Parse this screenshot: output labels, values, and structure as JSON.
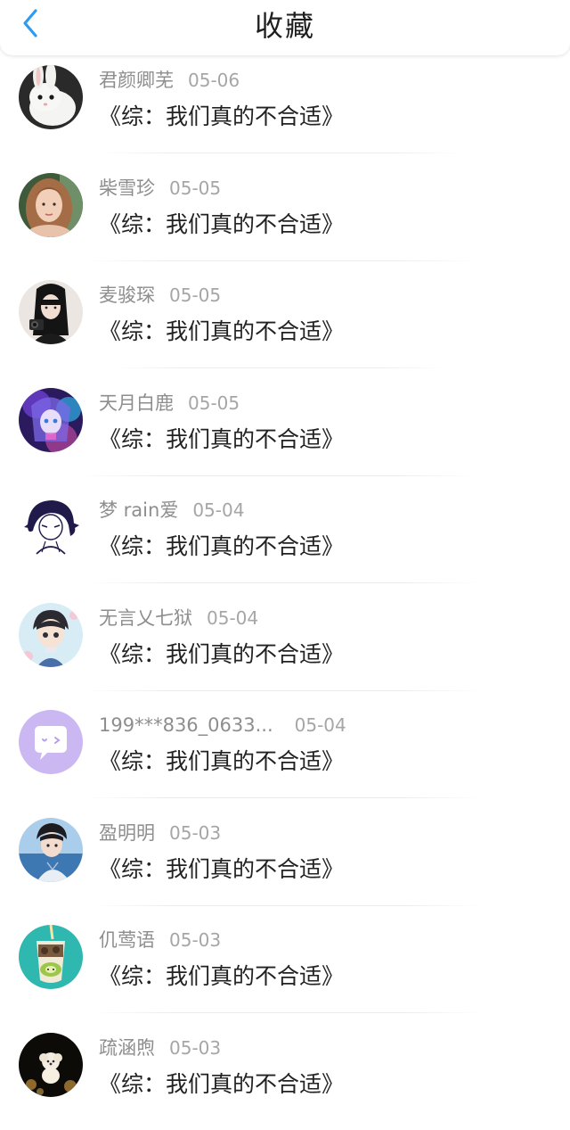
{
  "header": {
    "title": "收藏",
    "back_icon": "chevron-left-icon",
    "accent_color": "#2d9bf0"
  },
  "favorites": [
    {
      "name": "君颜卿芜",
      "date": "05-06",
      "title": "《综：我们真的不合适》",
      "avatar": "white-rabbit"
    },
    {
      "name": "柴雪珍",
      "date": "05-05",
      "title": "《综：我们真的不合适》",
      "avatar": "girl-portrait"
    },
    {
      "name": "麦骏琛",
      "date": "05-05",
      "title": "《综：我们真的不合适》",
      "avatar": "girl-with-camera"
    },
    {
      "name": "天月白鹿",
      "date": "05-05",
      "title": "《综：我们真的不合适》",
      "avatar": "anime-neon"
    },
    {
      "name": "梦 rain爱",
      "date": "05-04",
      "title": "《综：我们真的不合适》",
      "avatar": "anime-sketch"
    },
    {
      "name": "无言乂七狱",
      "date": "05-04",
      "title": "《综：我们真的不合适》",
      "avatar": "chibi-character"
    },
    {
      "name": "199***836_0633...",
      "date": "05-04",
      "title": "《综：我们真的不合适》",
      "avatar": "default-chat-bubble"
    },
    {
      "name": "盈明明",
      "date": "05-03",
      "title": "《综：我们真的不合适》",
      "avatar": "boy-by-sea"
    },
    {
      "name": "仉莺语",
      "date": "05-03",
      "title": "《综：我们真的不合适》",
      "avatar": "kiwi-drink"
    },
    {
      "name": "疏涵煦",
      "date": "05-03",
      "title": "《综：我们真的不合适》",
      "avatar": "dog-with-bokeh"
    }
  ]
}
